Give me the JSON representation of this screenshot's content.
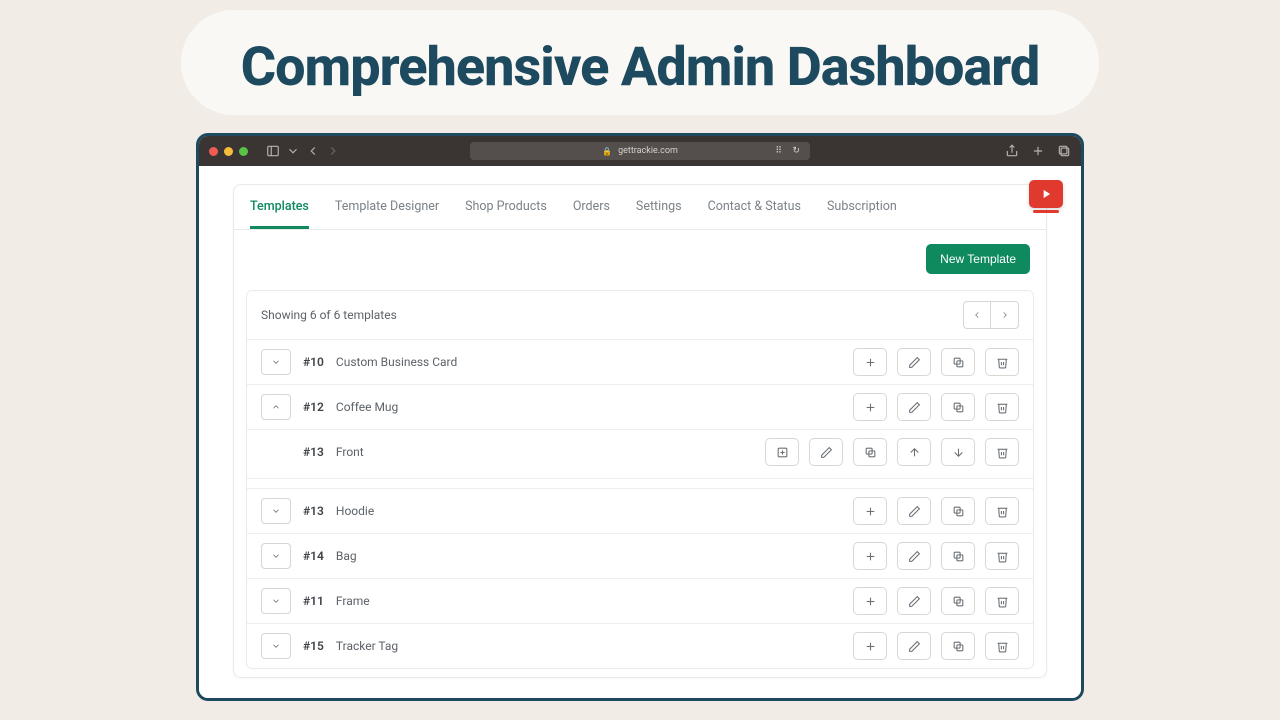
{
  "hero": {
    "title": "Comprehensive Admin Dashboard"
  },
  "browser": {
    "url": "gettrackie.com"
  },
  "tabs": [
    {
      "label": "Templates",
      "active": true
    },
    {
      "label": "Template Designer"
    },
    {
      "label": "Shop Products"
    },
    {
      "label": "Orders"
    },
    {
      "label": "Settings"
    },
    {
      "label": "Contact & Status"
    },
    {
      "label": "Subscription"
    }
  ],
  "actions": {
    "new_template": "New Template"
  },
  "list": {
    "showing": "Showing 6 of 6 templates",
    "rows": [
      {
        "id": "#10",
        "name": "Custom Business Card"
      },
      {
        "id": "#12",
        "name": "Coffee Mug",
        "expanded": true,
        "children": [
          {
            "id": "#13",
            "name": "Front"
          }
        ]
      },
      {
        "id": "#13",
        "name": "Hoodie"
      },
      {
        "id": "#14",
        "name": "Bag"
      },
      {
        "id": "#11",
        "name": "Frame"
      },
      {
        "id": "#15",
        "name": "Tracker Tag"
      }
    ]
  }
}
